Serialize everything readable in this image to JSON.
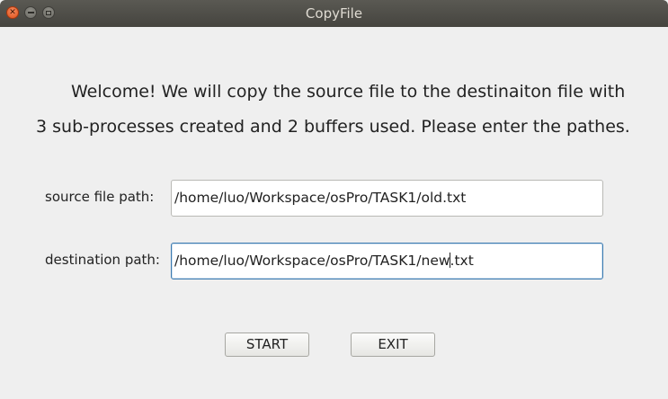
{
  "window": {
    "title": "CopyFile",
    "controls": [
      "close-icon",
      "minimize-icon",
      "maximize-icon"
    ]
  },
  "welcome": {
    "line1": "Welcome! We will copy the source file to the destinaiton file with",
    "line2": "3 sub-processes created and 2 buffers used. Please enter the pathes."
  },
  "form": {
    "source_label": "source file path:",
    "source_value": "/home/luo/Workspace/osPro/TASK1/old.txt",
    "destination_label": "destination path:",
    "destination_value_before_caret": "/home/luo/Workspace/osPro/TASK1/new",
    "destination_value_after_caret": ".txt"
  },
  "buttons": {
    "start": "START",
    "exit": "EXIT"
  },
  "colors": {
    "titlebar": "#4f4e49",
    "close_button": "#e95420",
    "background": "#efefef",
    "focus_border": "#3b7ab0"
  }
}
